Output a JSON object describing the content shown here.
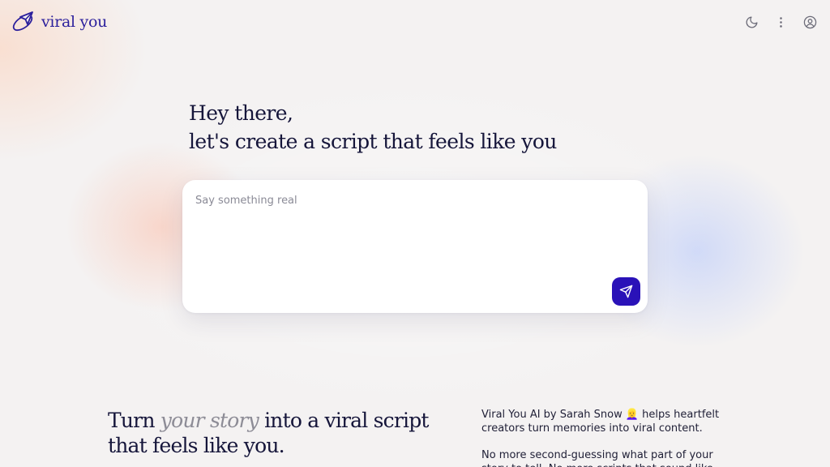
{
  "brand": {
    "name": "viral you",
    "color": "#2b1f9c"
  },
  "header": {
    "icons": [
      "moon-icon",
      "more-vertical-icon",
      "user-circle-icon"
    ]
  },
  "hero": {
    "line1": "Hey there,",
    "line2": "let's create a script that feels like you"
  },
  "composer": {
    "placeholder": "Say something real",
    "value": "",
    "send_icon": "send-icon",
    "send_color": "#2a12b8"
  },
  "tagline": {
    "part1": "Turn ",
    "emphasis": "your story",
    "part2": " into a viral script",
    "line2": "that feels like you."
  },
  "about": {
    "paragraph1": "Viral You AI by Sarah Snow 👱‍♀️ helps heartfelt creators turn memories into viral content.",
    "paragraph2": "No more second-guessing what part of your story to tell. No more scripts that sound like"
  }
}
